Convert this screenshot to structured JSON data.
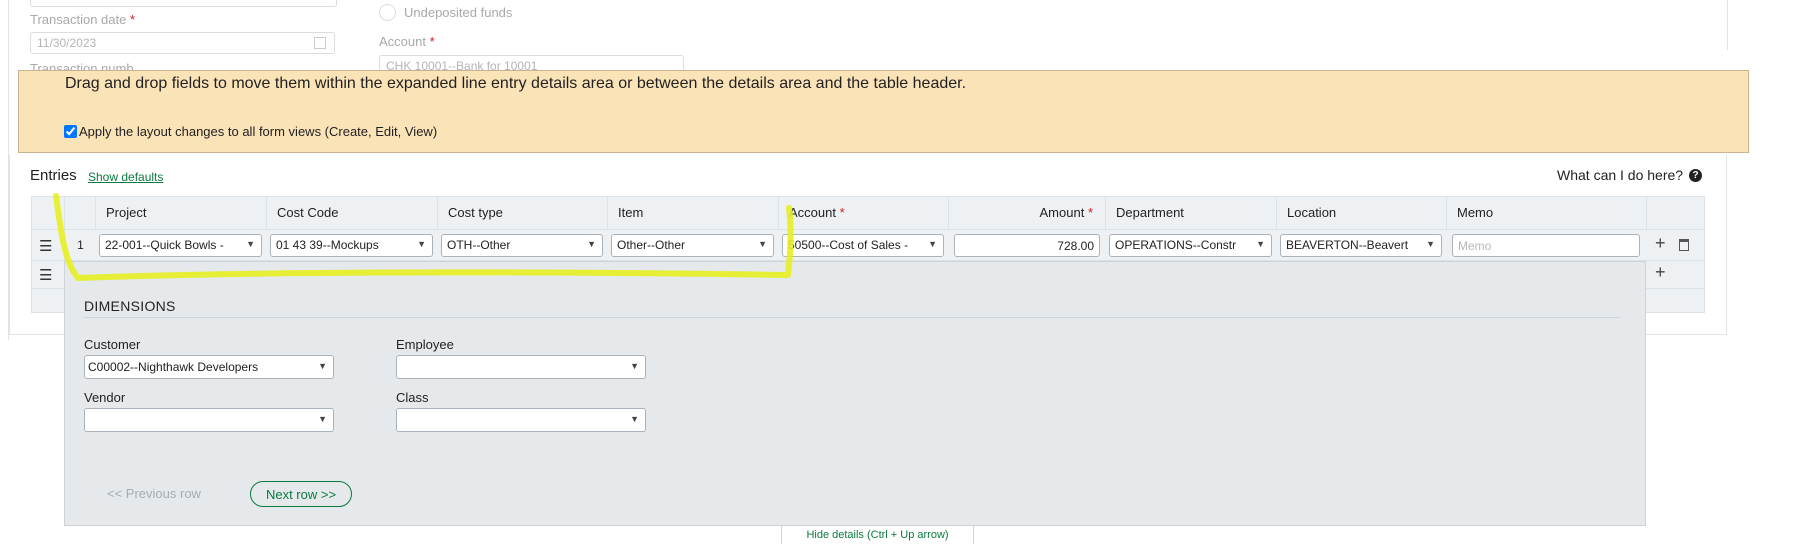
{
  "top_form": {
    "transaction_date_label": "Transaction date",
    "transaction_date_value": "11/30/2023",
    "transaction_number_label": "Transaction numb",
    "undeposited_label": "Undeposited funds",
    "account_label": "Account",
    "account_value": "CHK 10001--Bank for 10001",
    "required_mark": "*"
  },
  "banner": {
    "message": "Drag and drop fields to move them within the expanded line entry details area or between the details area and the table header.",
    "checkbox_label": "Apply the layout changes to all form views (Create, Edit, View)",
    "checkbox_checked": true
  },
  "entries": {
    "title": "Entries",
    "show_defaults": "Show defaults",
    "help_text": "What can I do here?",
    "help_icon": "question-circle-icon"
  },
  "table": {
    "columns": [
      "Project",
      "Cost Code",
      "Cost type",
      "Item",
      "Account",
      "Amount",
      "Department",
      "Location",
      "Memo"
    ],
    "required_mark": "*",
    "row": {
      "number": "1",
      "project": "22-001--Quick Bowls -",
      "cost_code": "01 43 39--Mockups",
      "cost_type": "OTH--Other",
      "item": "Other--Other",
      "account": "50500--Cost of Sales -",
      "amount": "728.00",
      "department": "OPERATIONS--Constr",
      "location": "BEAVERTON--Beavert",
      "memo_placeholder": "Memo"
    }
  },
  "details": {
    "title": "DIMENSIONS",
    "customer_label": "Customer",
    "customer_value": "C00002--Nighthawk Developers",
    "employee_label": "Employee",
    "employee_value": "",
    "vendor_label": "Vendor",
    "vendor_value": "",
    "class_label": "Class",
    "class_value": "",
    "prev_label": "<< Previous row",
    "next_label": "Next row >>",
    "hide_label": "Hide details (Ctrl + Up arrow)"
  },
  "colors": {
    "banner_bg": "#fbe3b8",
    "accent_green": "#0b7a3e",
    "highlight_yellow": "#e6ee22"
  }
}
